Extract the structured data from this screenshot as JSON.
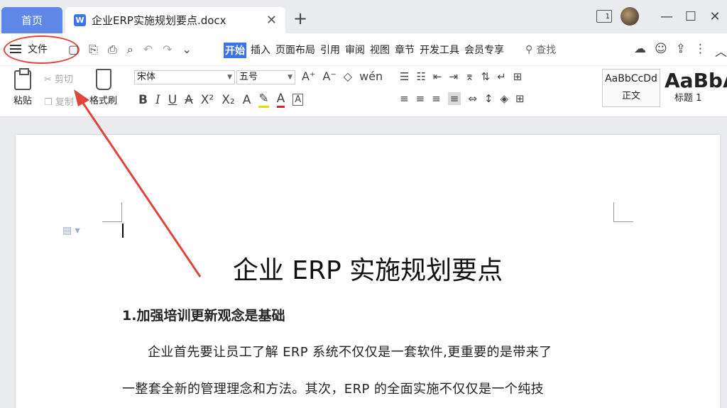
{
  "titlebar": {
    "home_tab": "首页",
    "doc_tab": "企业ERP实施规划要点.docx",
    "doc_icon_letter": "W",
    "close_glyph": "✕",
    "add_glyph": "+",
    "window_badge": "1",
    "minimize_glyph": "—",
    "maximize_glyph": "☐",
    "close_win_glyph": "✕"
  },
  "menubar": {
    "file_label": "文件",
    "tabs": [
      "开始",
      "插入",
      "页面布局",
      "引用",
      "审阅",
      "视图",
      "章节",
      "开发工具",
      "会员专享"
    ],
    "active_tab": "开始",
    "search_label": "查找"
  },
  "ribbon": {
    "paste": "粘贴",
    "cut": "剪切",
    "copy": "复制",
    "format_painter": "格式刷",
    "font": "宋体",
    "size": "五号",
    "style_normal_sample": "AaBbCcDd",
    "style_normal": "正文",
    "style_h1_sample": "AaBbA",
    "style_h1": "标题 1"
  },
  "document": {
    "title": "企业 ERP 实施规划要点",
    "heading1": "1.加强培训更新观念是基础",
    "para1_line1": "企业首先要让员工了解 ERP 系统不仅仅是一套软件,更重要的是带来了",
    "para1_line2": "一整套全新的管理理念和方法。其次，ERP 的全面实施不仅仅是一个纯技"
  },
  "colors": {
    "accent": "#3a74e8",
    "home_tab": "#5f87e8",
    "annotation": "#e0443a"
  }
}
